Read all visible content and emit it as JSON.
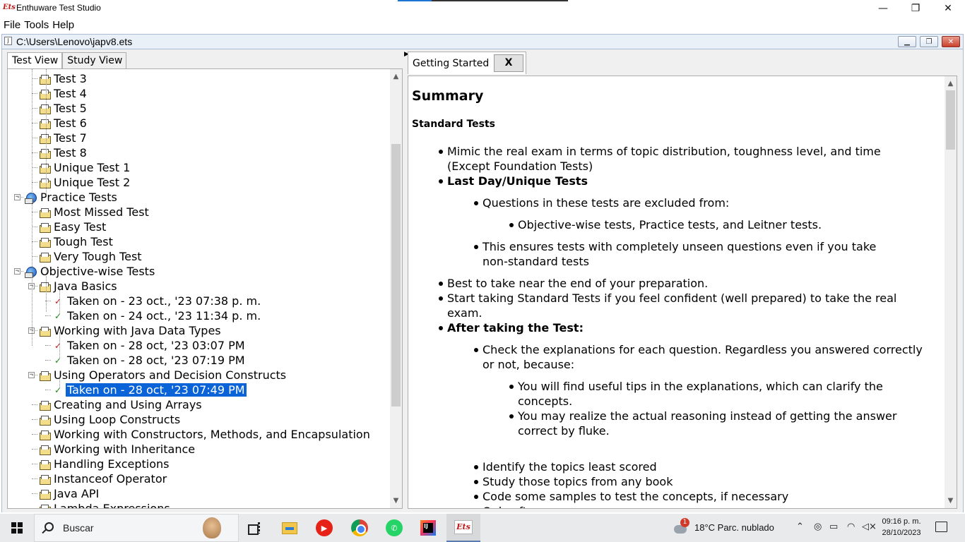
{
  "window": {
    "app_logo": "Ets",
    "title": "Enthuware Test Studio",
    "minimize": "—",
    "restore": "❐",
    "close": "✕"
  },
  "menu": [
    "File",
    "Tools",
    "Help"
  ],
  "internal_frame": {
    "title": "C:\\Users\\Lenovo\\japv8.ets"
  },
  "left_tabs": [
    "Test View",
    "Study View"
  ],
  "tree": [
    {
      "level": 2,
      "icon": "folder",
      "label": "Test 3"
    },
    {
      "level": 2,
      "icon": "folder",
      "label": "Test 4"
    },
    {
      "level": 2,
      "icon": "folder",
      "label": "Test 5"
    },
    {
      "level": 2,
      "icon": "folder",
      "label": "Test 6"
    },
    {
      "level": 2,
      "icon": "folder",
      "label": "Test 7"
    },
    {
      "level": 2,
      "icon": "folder",
      "label": "Test 8"
    },
    {
      "level": 2,
      "icon": "folder",
      "label": "Unique Test 1"
    },
    {
      "level": 2,
      "icon": "folder",
      "label": "Unique Test 2"
    },
    {
      "level": 1,
      "icon": "globe",
      "label": "Practice Tests",
      "toggle": "−"
    },
    {
      "level": 2,
      "icon": "folder",
      "label": "Most Missed Test"
    },
    {
      "level": 2,
      "icon": "folder",
      "label": "Easy Test"
    },
    {
      "level": 2,
      "icon": "folder",
      "label": "Tough Test"
    },
    {
      "level": 2,
      "icon": "folder",
      "label": "Very Tough Test"
    },
    {
      "level": 1,
      "icon": "globe",
      "label": "Objective-wise Tests",
      "toggle": "−"
    },
    {
      "level": 2,
      "icon": "folder",
      "label": "Java Basics",
      "toggle": "−"
    },
    {
      "level": 3,
      "icon": "fail",
      "label": "Taken on - 23 oct., '23 07:38 p. m."
    },
    {
      "level": 3,
      "icon": "pass",
      "label": "Taken on - 24 oct., '23 11:34 p. m."
    },
    {
      "level": 2,
      "icon": "folder",
      "label": "Working with Java Data Types",
      "toggle": "−"
    },
    {
      "level": 3,
      "icon": "fail",
      "label": "Taken on - 28 oct, '23 03:07 PM"
    },
    {
      "level": 3,
      "icon": "pass",
      "label": "Taken on - 28 oct, '23 07:19 PM"
    },
    {
      "level": 2,
      "icon": "folder",
      "label": "Using Operators and Decision Constructs",
      "toggle": "−"
    },
    {
      "level": 3,
      "icon": "pass",
      "label": "Taken on - 28 oct, '23 07:49 PM",
      "selected": true
    },
    {
      "level": 2,
      "icon": "folder",
      "label": "Creating and Using Arrays"
    },
    {
      "level": 2,
      "icon": "folder",
      "label": "Using Loop Constructs"
    },
    {
      "level": 2,
      "icon": "folder",
      "label": "Working with Constructors, Methods, and Encapsulation"
    },
    {
      "level": 2,
      "icon": "folder",
      "label": "Working with Inheritance"
    },
    {
      "level": 2,
      "icon": "folder",
      "label": "Handling Exceptions"
    },
    {
      "level": 2,
      "icon": "folder",
      "label": "Instanceof Operator"
    },
    {
      "level": 2,
      "icon": "folder",
      "label": "Java API"
    },
    {
      "level": 2,
      "icon": "folder",
      "label": "Lambda Expressions"
    }
  ],
  "right_tab": {
    "label": "Getting Started",
    "close": "X"
  },
  "content": {
    "heading": "Summary",
    "subheading": "Standard Tests",
    "items": [
      {
        "level": 1,
        "bold": false,
        "lines": [
          "Mimic the real exam in terms of topic distribution, toughness level, and time",
          "(Except Foundation Tests)"
        ]
      },
      {
        "level": 1,
        "bold": true,
        "lines": [
          "Last Day/Unique Tests"
        ]
      },
      {
        "level": 2,
        "bold": false,
        "lines": [
          "Questions in these tests are excluded from:"
        ]
      },
      {
        "level": 3,
        "bold": false,
        "lines": [
          "Objective-wise tests, Practice tests, and Leitner tests."
        ]
      },
      {
        "level": 2,
        "bold": false,
        "lines": [
          "This ensures tests with completely unseen questions even if you take",
          "non-standard tests"
        ]
      },
      {
        "level": 1,
        "bold": false,
        "lines": [
          "Best to take near the end of your preparation."
        ]
      },
      {
        "level": 1,
        "bold": false,
        "lines": [
          "Start taking Standard Tests if you feel confident (well prepared) to take the real",
          "exam."
        ]
      },
      {
        "level": 1,
        "bold": true,
        "lines": [
          "After taking the Test:"
        ]
      },
      {
        "level": 2,
        "bold": false,
        "lines": [
          "Check the explanations for each question. Regardless you answered correctly",
          "or not, because:"
        ]
      },
      {
        "level": 3,
        "bold": false,
        "lines": [
          "You will find useful tips in the explanations, which can clarify the",
          "concepts."
        ]
      },
      {
        "level": 3,
        "bold": false,
        "lines": [
          "You may realize the actual reasoning instead of getting the answer",
          "correct by fluke."
        ]
      },
      {
        "level": 2,
        "bold": false,
        "lines": [
          "Identify the topics least scored"
        ]
      },
      {
        "level": 2,
        "bold": false,
        "lines": [
          "Study those topics from any book"
        ]
      },
      {
        "level": 2,
        "bold": false,
        "lines": [
          "Code some samples to test the concepts, if necessary"
        ]
      },
      {
        "level": 2,
        "bold": false,
        "lines": [
          "Only after..."
        ]
      }
    ]
  },
  "taskbar": {
    "search_placeholder": "Buscar",
    "apps": [
      "task-view",
      "file-explorer",
      "youtube",
      "chrome",
      "whatsapp",
      "intellij",
      "enthuware"
    ],
    "weather": "18°C  Parc. nublado",
    "time": "09:16 p. m.",
    "date": "28/10/2023"
  }
}
